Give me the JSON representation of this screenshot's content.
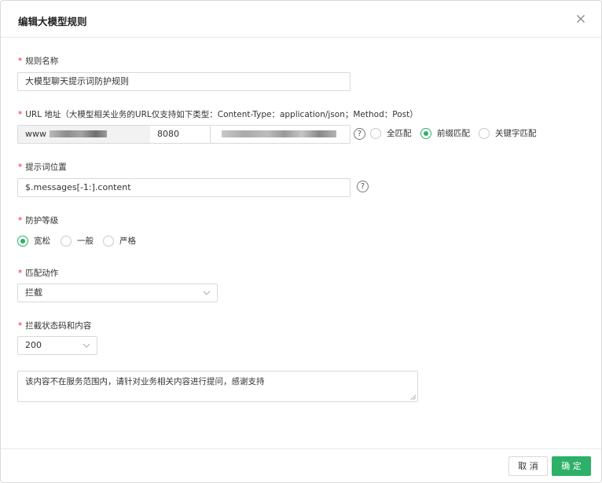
{
  "dialog": {
    "title": "编辑大模型规则"
  },
  "form": {
    "required_mark": "*",
    "rule_name": {
      "label": "规则名称",
      "value": "大模型聊天提示词防护规则"
    },
    "url": {
      "label": "URL 地址（大模型相关业务的URL仅支持如下类型：Content-Type：application/json；Method：Post）",
      "host_prefix": "www",
      "port": "8080",
      "help": "?",
      "match_options": [
        {
          "label": "全匹配",
          "checked": false
        },
        {
          "label": "前缀匹配",
          "checked": true
        },
        {
          "label": "关键字匹配",
          "checked": false
        }
      ]
    },
    "prompt_position": {
      "label": "提示词位置",
      "value": "$.messages[-1:].content",
      "help": "?"
    },
    "protection_level": {
      "label": "防护等级",
      "options": [
        {
          "label": "宽松",
          "checked": true
        },
        {
          "label": "一般",
          "checked": false
        },
        {
          "label": "严格",
          "checked": false
        }
      ]
    },
    "match_action": {
      "label": "匹配动作",
      "selected": "拦截"
    },
    "block_response": {
      "label": "拦截状态码和内容",
      "status_code": "200",
      "content": "该内容不在服务范围内，请针对业务相关内容进行提问，感谢支持"
    }
  },
  "footer": {
    "cancel_label": "取 消",
    "ok_label": "确 定"
  },
  "colors": {
    "accent": "#2db067",
    "required": "#f5222d"
  }
}
